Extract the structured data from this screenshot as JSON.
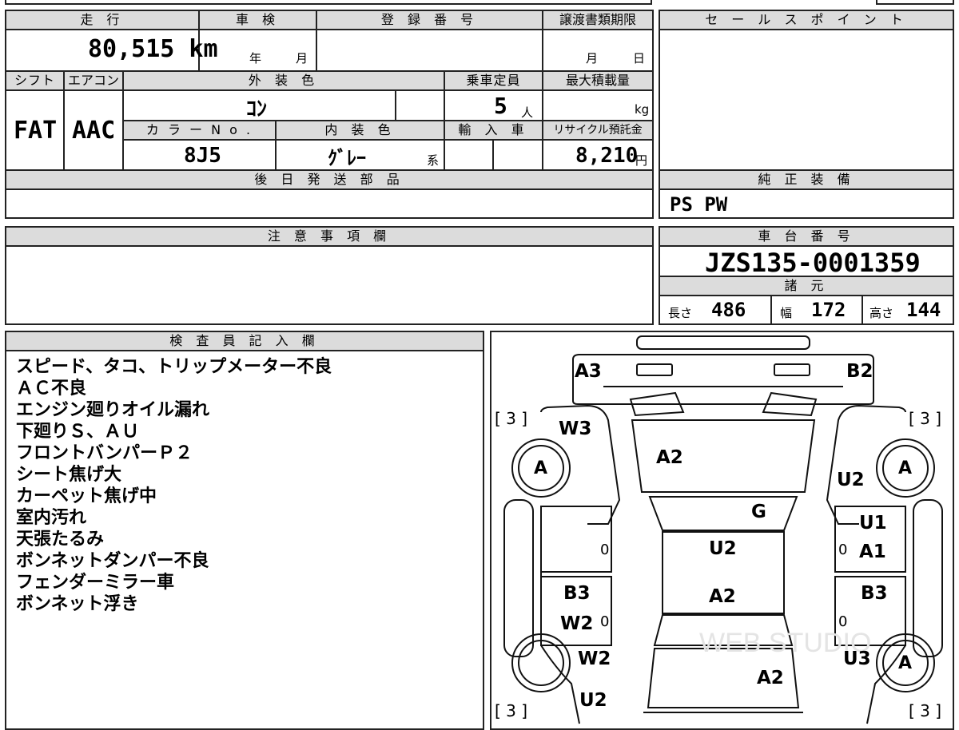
{
  "vehicle": {
    "mileage": "80,515 km",
    "inspection": {
      "year_label": "年",
      "month_label": "月"
    },
    "registration_number": "",
    "transfer_deadline": {
      "month_label": "月",
      "day_label": "日"
    },
    "shift": "FAT",
    "aircon": "AAC",
    "exterior_color": "ｺﾝ",
    "capacity": "5",
    "capacity_unit": "人",
    "max_load_unit": "kg",
    "color_no": "8J5",
    "interior_color": "ｸﾞﾚｰ",
    "interior_suffix": "系",
    "recycle_fee": "8,210",
    "recycle_unit": "円",
    "standard_equipment": "PS PW",
    "chassis_number": "JZS135-0001359",
    "dims": {
      "length_label": "長さ",
      "length": "486",
      "width_label": "幅",
      "width": "172",
      "height_label": "高さ",
      "height": "144"
    }
  },
  "headers": {
    "mileage": "走 行",
    "inspection": "車 検",
    "registration": "登 録 番 号",
    "transfer": "譲渡書類期限",
    "sales_point": "セ ー ル ス ポ イ ン ト",
    "shift": "シフト",
    "aircon": "エアコン",
    "exterior": "外 装 色",
    "capacity": "乗車定員",
    "max_load": "最大積載量",
    "color_no": "カ ラ ー N o .",
    "interior": "内 装 色",
    "import": "輸 入 車",
    "recycle": "リサイクル預託金",
    "later_parts": "後 日 発 送 部 品",
    "standard_equipment": "純 正 装 備",
    "notes": "注 意 事 項 欄",
    "chassis": "車 台 番 号",
    "specs": "諸 元",
    "inspector": "検 査 員 記 入 欄"
  },
  "inspector_remarks": [
    "スピード、タコ、トリップメーター不良",
    "ＡＣ不良",
    "エンジン廻りオイル漏れ",
    "下廻りＳ、ＡＵ",
    "フロントバンパーＰ２",
    "シート焦げ大",
    "カーペット焦げ中",
    "室内汚れ",
    "天張たるみ",
    "ボンネットダンパー不良",
    "フェンダーミラー車",
    "ボンネット浮き"
  ],
  "diagram": {
    "tire_fl": "A",
    "tire_fr": "A",
    "tire_rr": "A",
    "tread_fl": "[ 3 ]",
    "tread_fr": "[ 3 ]",
    "tread_rl": "[ 3 ]",
    "tread_rr": "[ 3 ]",
    "front_left": "A3",
    "front_right": "B2",
    "fender_left": "W3",
    "hood": "A2",
    "fender_right": "U2",
    "windshield": "G",
    "roof": "U2",
    "roof_lower": "A2",
    "right_front_door_1": "U1",
    "right_front_door_2": "A1",
    "left_rear_door_1": "B3",
    "left_rear_door_2": "W2",
    "right_rear_door": "B3",
    "rear_left": "W2",
    "rear_right": "U3",
    "trunk": "A2",
    "bottom_left": "U2",
    "zero_l1": "0",
    "zero_r1": "0",
    "zero_l2": "0",
    "zero_r2": "0"
  },
  "watermark": "WEB STUDIO"
}
